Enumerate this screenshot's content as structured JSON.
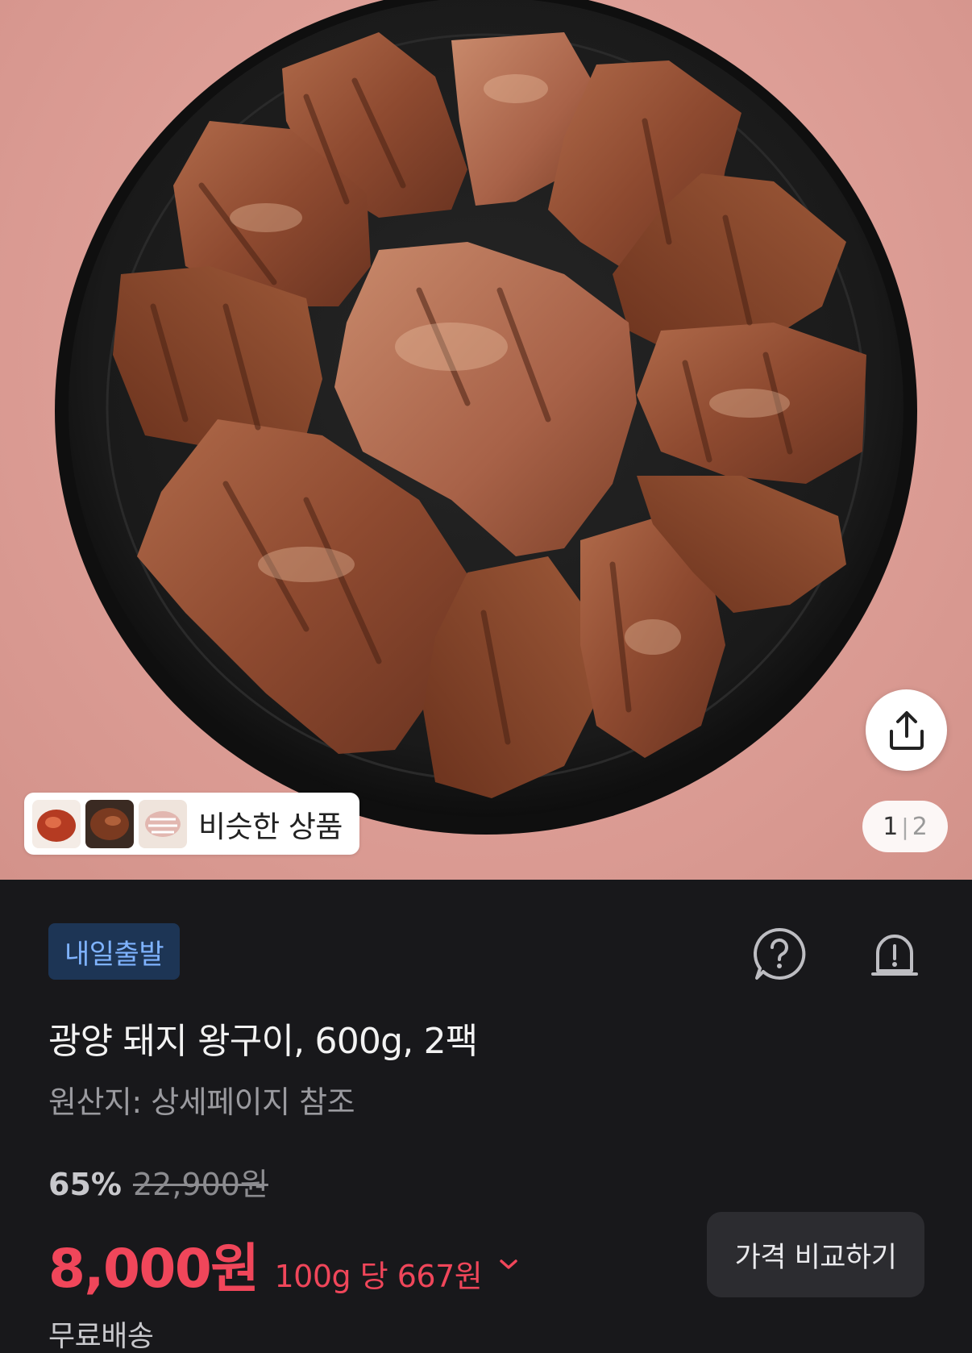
{
  "hero": {
    "similar_label": "비슷한 상품",
    "pager_current": "1",
    "pager_separator": "|",
    "pager_total": "2",
    "share_icon": "share-icon"
  },
  "product": {
    "badge": "내일출발",
    "title": "광양 돼지 왕구이, 600g, 2팩",
    "origin": "원산지: 상세페이지 참조",
    "discount": "65%",
    "original_price": "22,900원",
    "price": "8,000원",
    "unit_price": "100g 당 667원",
    "compare_button": "가격 비교하기",
    "shipping": "무료배송"
  },
  "icons": {
    "help": "question-circle-icon",
    "alert": "alarm-bell-icon",
    "expand": "chevron-down-icon"
  },
  "colors": {
    "background": "#18181b",
    "price_red": "#f0465a",
    "badge_bg": "#1d3555",
    "badge_text": "#7fb3ff",
    "hero_bg": "#dd9e96"
  }
}
